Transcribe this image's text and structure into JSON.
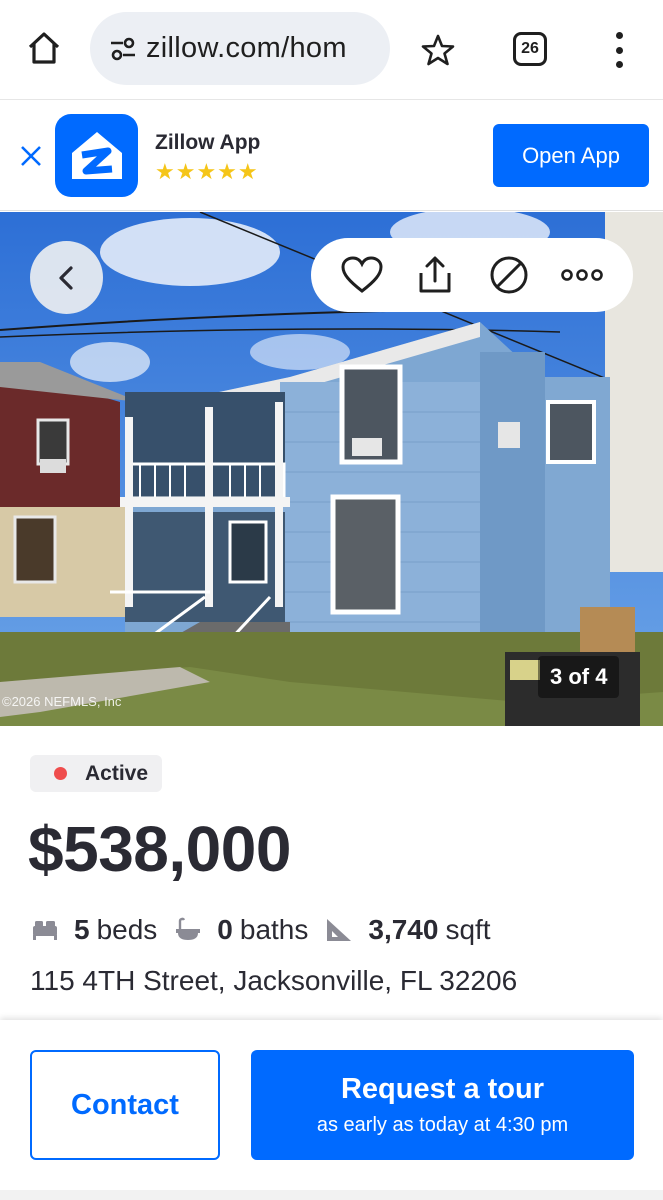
{
  "browser": {
    "url": "zillow.com/hom",
    "tab_count": "26",
    "icons": [
      "home-icon",
      "site-settings-icon",
      "bookmark-star-icon",
      "tab-switcher-icon",
      "menu-icon"
    ]
  },
  "app_banner": {
    "app_name": "Zillow App",
    "stars": "★★★★★",
    "rating": 5,
    "open_label": "Open App"
  },
  "gallery": {
    "counter": "3 of 4",
    "watermark": "©2026 NEFMLS, Inc",
    "actions": [
      "save-heart-icon",
      "share-icon",
      "hide-icon",
      "more-icon"
    ]
  },
  "listing": {
    "status": "Active",
    "price": "$538,000",
    "beds_value": "5",
    "beds_label": "beds",
    "baths_value": "0",
    "baths_label": "baths",
    "sqft_value": "3,740",
    "sqft_label": "sqft",
    "address": "115 4TH Street, Jacksonville, FL 32206"
  },
  "cta": {
    "contact_label": "Contact",
    "tour_label": "Request a tour",
    "tour_sub": "as early as today at 4:30 pm"
  },
  "colors": {
    "brand_blue": "#006aff",
    "status_red": "#ef4d4d",
    "text": "#2a2a33"
  }
}
